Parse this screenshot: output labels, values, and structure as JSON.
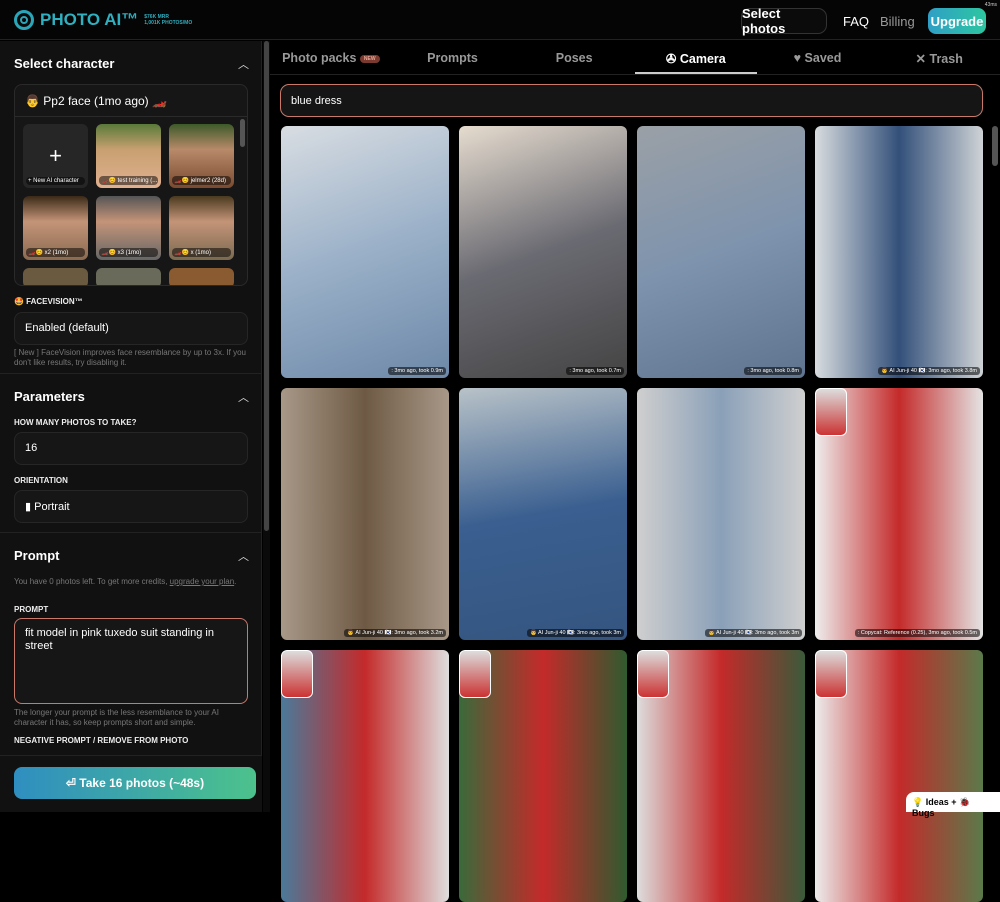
{
  "header": {
    "logo": "PHOTO AI™",
    "stats": [
      "$76K MRR",
      "1,001K PHOTOS/MO"
    ],
    "select_photos": "Select photos",
    "faq": "FAQ",
    "billing": "Billing",
    "upgrade": "Upgrade",
    "timing": "43ms"
  },
  "sidebar": {
    "select_character": "Select character",
    "current_character": "👨 Pp2 face (1mo ago) 🏎️",
    "characters": [
      "+ New AI character",
      "🏎️😊 test training (...",
      "🏎️😊 jelmer2 (28d)",
      "🏎️😊 x2 (1mo)",
      "🏎️😊 x3 (1mo)",
      "🏎️😊 x (1mo)"
    ],
    "facevision_label": "🤩 FACEVISION™",
    "facevision_value": "Enabled (default)",
    "facevision_help": "[ New ] FaceVision improves face resemblance by up to 3x. If you don't like results, try disabling it.",
    "parameters": "Parameters",
    "how_many_label": "HOW MANY PHOTOS TO TAKE?",
    "how_many_value": "16",
    "orientation_label": "ORIENTATION",
    "orientation_value": "▮ Portrait",
    "prompt_title": "Prompt",
    "credits_text": "You have 0 photos left. To get more credits, ",
    "credits_link": "upgrade your plan",
    "prompt_label": "PROMPT",
    "prompt_value": "fit model in pink tuxedo suit standing in street",
    "prompt_help": "The longer your prompt is the less resemblance to your AI character it has, so keep prompts short and simple.",
    "negative_label": "NEGATIVE PROMPT / REMOVE FROM PHOTO",
    "take_button": "⏎ Take 16 photos (~48s)"
  },
  "tabs": [
    {
      "label": "Photo packs",
      "badge": "NEW"
    },
    {
      "label": "Prompts"
    },
    {
      "label": "Poses"
    },
    {
      "label": "Camera",
      "icon": "✇"
    },
    {
      "label": "Saved",
      "icon": "♥"
    },
    {
      "label": "Trash",
      "icon": "✕"
    }
  ],
  "search": {
    "value": "blue dress"
  },
  "photos": [
    {
      "caption": ": 3mo ago, took 0.9m"
    },
    {
      "caption": ": 3mo ago, took 0.7m"
    },
    {
      "caption": ": 3mo ago, took 0.8m"
    },
    {
      "caption": "👨 AI Jun-ji 40 🇰🇷: 3mo ago, took 3.8m"
    },
    {
      "caption": "👨 AI Jun-ji 40 🇰🇷: 3mo ago, took 3.2m"
    },
    {
      "caption": "👨 AI Jun-ji 40 🇰🇷: 3mo ago, took 3m"
    },
    {
      "caption": "👨 AI Jun-ji 40 🇰🇷: 3mo ago, took 3m"
    },
    {
      "caption": ": Copycat: Reference (0.25), 3mo ago, took 0.5m"
    },
    {
      "caption": ""
    },
    {
      "caption": ""
    },
    {
      "caption": ""
    },
    {
      "caption": ""
    }
  ],
  "ideas": "💡 Ideas + 🐞 Bugs"
}
